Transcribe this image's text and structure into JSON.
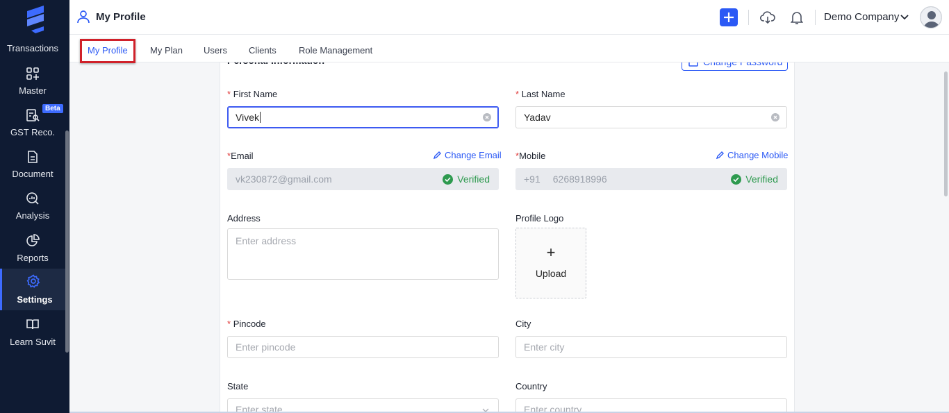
{
  "sidebar": {
    "items": [
      {
        "label": "Transactions",
        "icon": "transactions-icon"
      },
      {
        "label": "Master",
        "icon": "grid-plus-icon"
      },
      {
        "label": "GST Reco.",
        "icon": "reconcile-icon",
        "badge": "Beta"
      },
      {
        "label": "Document",
        "icon": "document-icon"
      },
      {
        "label": "Analysis",
        "icon": "analysis-icon"
      },
      {
        "label": "Reports",
        "icon": "pie-chart-icon"
      },
      {
        "label": "Settings",
        "icon": "gear-icon",
        "active": true
      },
      {
        "label": "Learn Suvit",
        "icon": "book-icon"
      }
    ]
  },
  "header": {
    "title": "My Profile",
    "company": "Demo Company"
  },
  "tabs": [
    {
      "label": "My Profile",
      "active": true
    },
    {
      "label": "My Plan"
    },
    {
      "label": "Users"
    },
    {
      "label": "Clients"
    },
    {
      "label": "Role Management"
    }
  ],
  "section": {
    "title": "Personal Information",
    "change_password": "Change Password"
  },
  "form": {
    "first_name": {
      "label": "First Name",
      "required": "*",
      "value": "Vivek"
    },
    "last_name": {
      "label": "Last Name",
      "required": "*",
      "value": "Yadav"
    },
    "email": {
      "label": "Email",
      "required": "*",
      "value": "vk230872@gmail.com",
      "change": "Change Email",
      "status": "Verified"
    },
    "mobile": {
      "label": "Mobile",
      "required": "*",
      "prefix": "+91",
      "value": "6268918996",
      "change": "Change Mobile",
      "status": "Verified"
    },
    "address": {
      "label": "Address",
      "placeholder": "Enter address"
    },
    "profile_logo": {
      "label": "Profile Logo",
      "plus": "+",
      "upload": "Upload"
    },
    "pincode": {
      "label": "Pincode",
      "required": "*",
      "placeholder": "Enter pincode"
    },
    "city": {
      "label": "City",
      "placeholder": "Enter city"
    },
    "state": {
      "label": "State",
      "placeholder": "Enter state"
    },
    "country": {
      "label": "Country",
      "placeholder": "Enter country"
    }
  },
  "colors": {
    "sidebar_bg": "#0f1b33",
    "accent": "#2b59f5",
    "verified": "#2e9a4f",
    "required": "#e03a3a",
    "highlight": "#d0212a"
  }
}
